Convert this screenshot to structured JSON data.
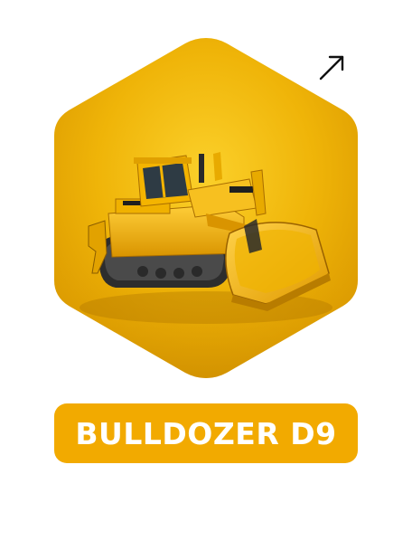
{
  "product": {
    "title": "BULLDOZER D9",
    "description": "",
    "image_name": "bulldozer-image",
    "brand_color": "#f2aa00",
    "hex_bg_light": "#f8c418",
    "hex_bg_dark": "#d99700"
  },
  "action": {
    "icon": "arrow-up-right-icon"
  }
}
